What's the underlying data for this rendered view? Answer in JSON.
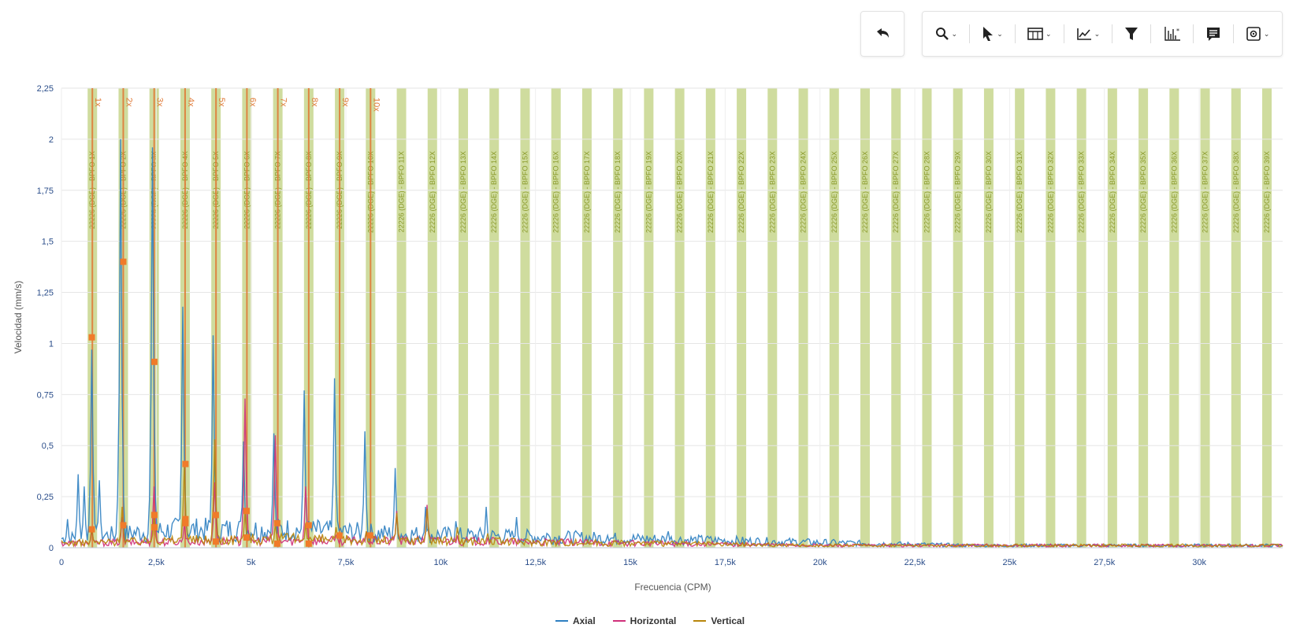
{
  "toolbar": {
    "undo_icon": "undo-arrow-icon",
    "buttons": [
      {
        "name": "zoom",
        "icon": "magnifier-icon",
        "dropdown": true
      },
      {
        "name": "select",
        "icon": "pointer-icon",
        "dropdown": true
      },
      {
        "name": "layout",
        "icon": "columns-icon",
        "dropdown": true
      },
      {
        "name": "trend",
        "icon": "line-chart-icon",
        "dropdown": true
      },
      {
        "name": "filter",
        "icon": "funnel-icon",
        "dropdown": false
      },
      {
        "name": "peaks",
        "icon": "peak-chart-icon",
        "dropdown": false
      },
      {
        "name": "comments",
        "icon": "comment-icon",
        "dropdown": false
      },
      {
        "name": "settings",
        "icon": "settings-icon",
        "dropdown": true
      }
    ]
  },
  "chart_data": {
    "type": "line",
    "xlabel": "Frecuencia (CPM)",
    "ylabel": "Velocidad (mm/s)",
    "xlim": [
      0,
      32200
    ],
    "ylim": [
      0,
      2.25
    ],
    "x_ticks": [
      0,
      2500,
      5000,
      7500,
      10000,
      12500,
      15000,
      17500,
      20000,
      22500,
      25000,
      27500,
      30000
    ],
    "x_tick_labels": [
      "0",
      "2,5k",
      "5k",
      "7,5k",
      "10k",
      "12,5k",
      "15k",
      "17,5k",
      "20k",
      "22,5k",
      "25k",
      "27,5k",
      "30k"
    ],
    "y_ticks": [
      0,
      0.25,
      0.5,
      0.75,
      1,
      1.25,
      1.5,
      1.75,
      2,
      2.25
    ],
    "y_tick_labels": [
      "0",
      "0,25",
      "0,5",
      "0,75",
      "1",
      "1,25",
      "1,5",
      "1,75",
      "2",
      "2,25"
    ],
    "grid": true,
    "legend_position": "bottom-center",
    "series": [
      {
        "name": "Axial",
        "color": "#2e7fc1",
        "peaks": [
          [
            160,
            0.14
          ],
          [
            450,
            0.36
          ],
          [
            610,
            0.3
          ],
          [
            800,
            0.97
          ],
          [
            1000,
            0.33
          ],
          [
            1570,
            2.0
          ],
          [
            2400,
            1.96
          ],
          [
            3200,
            1.18
          ],
          [
            4000,
            1.04
          ],
          [
            4800,
            0.52
          ],
          [
            5600,
            0.56
          ],
          [
            6400,
            0.77
          ],
          [
            7200,
            0.83
          ],
          [
            8000,
            0.57
          ],
          [
            8800,
            0.39
          ],
          [
            9600,
            0.2
          ],
          [
            10400,
            0.13
          ],
          [
            11200,
            0.2
          ],
          [
            12000,
            0.15
          ],
          [
            12800,
            0.07
          ],
          [
            13600,
            0.07
          ],
          [
            14400,
            0.06
          ],
          [
            15200,
            0.06
          ],
          [
            16000,
            0.08
          ],
          [
            17000,
            0.05
          ]
        ],
        "baseline": [
          [
            0,
            0.04
          ],
          [
            3000,
            0.08
          ],
          [
            6000,
            0.08
          ],
          [
            9000,
            0.06
          ],
          [
            12000,
            0.05
          ],
          [
            15000,
            0.04
          ],
          [
            18000,
            0.03
          ],
          [
            21000,
            0.02
          ],
          [
            24000,
            0.01
          ],
          [
            32200,
            0.01
          ]
        ]
      },
      {
        "name": "Horizontal",
        "color": "#d0307a",
        "peaks": [
          [
            800,
            0.09
          ],
          [
            1600,
            0.15
          ],
          [
            2420,
            0.3
          ],
          [
            3230,
            0.12
          ],
          [
            4030,
            0.32
          ],
          [
            4830,
            0.73
          ],
          [
            5630,
            0.55
          ],
          [
            6450,
            0.3
          ],
          [
            7230,
            0.06
          ],
          [
            8040,
            0.08
          ],
          [
            8840,
            0.18
          ],
          [
            9640,
            0.21
          ],
          [
            10450,
            0.06
          ],
          [
            11250,
            0.05
          ]
        ],
        "baseline": [
          [
            0,
            0.02
          ],
          [
            5000,
            0.03
          ],
          [
            10000,
            0.03
          ],
          [
            15000,
            0.02
          ],
          [
            20000,
            0.01
          ],
          [
            32200,
            0.01
          ]
        ]
      },
      {
        "name": "Vertical",
        "color": "#b8860b",
        "peaks": [
          [
            800,
            0.1
          ],
          [
            1600,
            0.2
          ],
          [
            2420,
            0.16
          ],
          [
            3230,
            0.41
          ],
          [
            4030,
            0.53
          ],
          [
            4830,
            0.18
          ],
          [
            5630,
            0.12
          ],
          [
            6450,
            0.12
          ],
          [
            7230,
            0.1
          ],
          [
            8040,
            0.08
          ],
          [
            8840,
            0.17
          ],
          [
            9640,
            0.19
          ],
          [
            10450,
            0.1
          ],
          [
            11250,
            0.07
          ]
        ],
        "baseline": [
          [
            0,
            0.02
          ],
          [
            5000,
            0.04
          ],
          [
            10000,
            0.03
          ],
          [
            15000,
            0.02
          ],
          [
            20000,
            0.01
          ],
          [
            32200,
            0.01
          ]
        ]
      }
    ],
    "markers": [
      [
        800,
        1.03
      ],
      [
        800,
        0.09
      ],
      [
        1630,
        1.4
      ],
      [
        1630,
        0.11
      ],
      [
        2450,
        0.91
      ],
      [
        2450,
        0.16
      ],
      [
        2450,
        0.1
      ],
      [
        3270,
        0.41
      ],
      [
        3270,
        0.14
      ],
      [
        3270,
        0.12
      ],
      [
        4070,
        0.16
      ],
      [
        4070,
        0.03
      ],
      [
        4880,
        0.18
      ],
      [
        4880,
        0.05
      ],
      [
        5690,
        0.12
      ],
      [
        5690,
        0.02
      ],
      [
        6520,
        0.11
      ],
      [
        6520,
        0.02
      ],
      [
        7330,
        0.06
      ],
      [
        8140,
        0.06
      ]
    ],
    "harmonic_lines": {
      "color": "#e07b39",
      "positions": [
        815,
        1630,
        2445,
        3260,
        4075,
        4890,
        5705,
        6520,
        7335,
        8150
      ],
      "labels": [
        "1x",
        "2x",
        "3x",
        "4x",
        "5x",
        "6x",
        "7x",
        "8x",
        "9x",
        "10x"
      ]
    },
    "bpfo_bands": {
      "color": "#b5c96a",
      "spacing": 815,
      "count": 39,
      "label_prefix": "22226 (DGE) - BPFO ",
      "labels": [
        "1X",
        "2X",
        "3X",
        "4X",
        "5X",
        "6X",
        "7X",
        "8X",
        "9X",
        "10X",
        "11X",
        "12X",
        "13X",
        "14X",
        "15X",
        "16X",
        "17X",
        "18X",
        "19X",
        "20X",
        "21X",
        "22X",
        "23X",
        "24X",
        "25X",
        "26X",
        "27X",
        "28X",
        "29X",
        "30X",
        "31X",
        "32X",
        "33X",
        "34X",
        "35X",
        "36X",
        "37X",
        "38X",
        "39X"
      ]
    }
  }
}
